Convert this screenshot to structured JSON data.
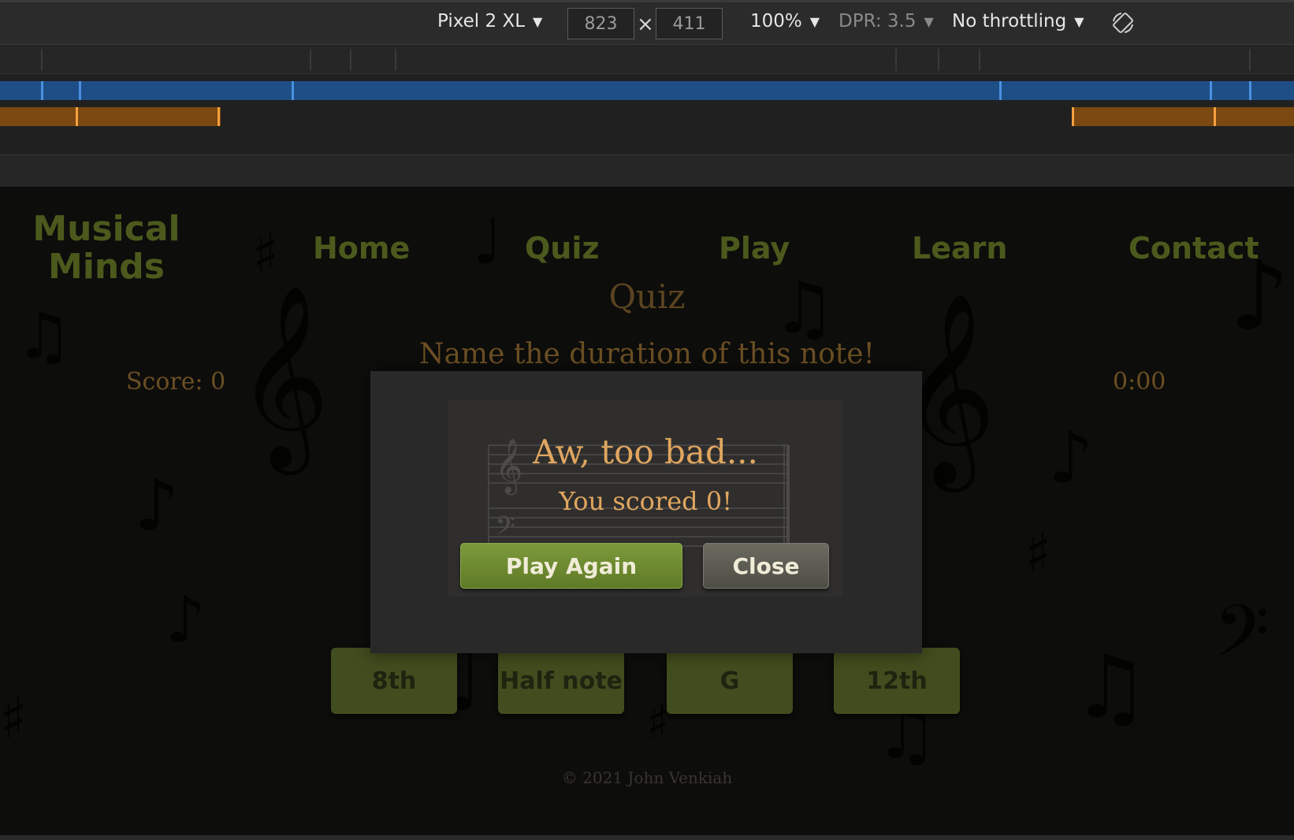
{
  "devtools": {
    "device": "Pixel 2 XL",
    "width": "823",
    "height": "411",
    "dimension_separator": "×",
    "zoom": "100%",
    "dpr": "DPR: 3.5",
    "throttling": "No throttling",
    "caret": "▼",
    "icons": {
      "rotate": "rotate-icon"
    },
    "colors": {
      "blue_track": "#1e4e86",
      "orange_track": "#7a4810",
      "marker_blue": "#4a90e2",
      "marker_orange": "#f5a040"
    }
  },
  "site": {
    "logo": "Musical Minds",
    "nav": [
      "Home",
      "Quiz",
      "Play",
      "Learn",
      "Contact"
    ],
    "page_title": "Quiz",
    "question": "Name the duration of this note!",
    "score": "Score: 0",
    "timer": "0:00",
    "answers": [
      "8th",
      "Half note",
      "G",
      "12th"
    ],
    "copyright": "© 2021 John Venkiah"
  },
  "modal": {
    "title": "Aw, too bad...",
    "subtitle": "You scored 0!",
    "play_again": "Play Again",
    "close": "Close"
  }
}
